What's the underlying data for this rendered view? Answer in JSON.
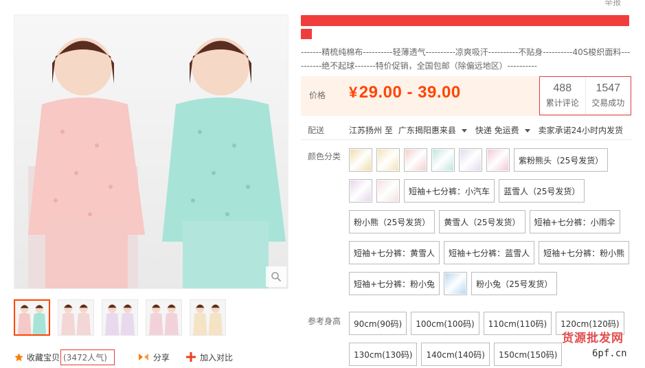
{
  "header": {
    "report_label": "举报"
  },
  "product": {
    "subtitle": "-------精梳纯棉布----------轻薄透气----------凉爽吸汗----------不贴身----------40S梭织面料----------绝不起球-------特价促销，全国包邮（除偏远地区）----------"
  },
  "gallery": {
    "thumbnail_count": 5,
    "active_thumbnail": 0,
    "thumb_colors": [
      "#f6c9c9",
      "#f3d6d6",
      "#e9d9ee",
      "#f2d2da",
      "#f4e3c5"
    ]
  },
  "actions": {
    "favorite_label": "收藏宝贝",
    "popularity": "(3472人气)",
    "share_label": "分享",
    "compare_label": "加入对比"
  },
  "price": {
    "label": "价格",
    "currency": "¥",
    "range": "29.00 - 39.00"
  },
  "stats": {
    "reviews_count": "488",
    "reviews_label": "累计评论",
    "deals_count": "1547",
    "deals_label": "交易成功"
  },
  "shipping": {
    "label": "配送",
    "origin": "江苏扬州 至",
    "destination": "广东揭阳惠来县",
    "method": "快递 免运费",
    "promise": "卖家承诺24小时内发货"
  },
  "sku": {
    "color_label": "颜色分类",
    "colors": [
      {
        "type": "image",
        "swatch": "#f1dca9"
      },
      {
        "type": "image",
        "swatch": "#f3e3b8"
      },
      {
        "type": "image",
        "swatch": "#f3cfcf"
      },
      {
        "type": "image",
        "swatch": "#bfe6df"
      },
      {
        "type": "image",
        "swatch": "#e3dbee"
      },
      {
        "type": "image",
        "swatch": "#f2c9d3"
      },
      {
        "type": "text",
        "label": "紫粉熊头（25号发货）"
      },
      {
        "type": "image",
        "swatch": "#e6d6ec"
      },
      {
        "type": "image",
        "swatch": "#f6e0e0"
      },
      {
        "type": "text",
        "label": "短袖+七分裤：小汽车"
      },
      {
        "type": "text",
        "label": "蓝雪人（25号发货）"
      },
      {
        "type": "text",
        "label": "粉小熊（25号发货）"
      },
      {
        "type": "text",
        "label": "黄雪人（25号发货）"
      },
      {
        "type": "text",
        "label": "短袖+七分裤：小雨伞"
      },
      {
        "type": "text",
        "label": "短袖+七分裤：黄雪人"
      },
      {
        "type": "text",
        "label": "短袖+七分裤：蓝雪人"
      },
      {
        "type": "text",
        "label": "短袖+七分裤：粉小熊"
      },
      {
        "type": "text",
        "label": "短袖+七分裤：粉小兔"
      },
      {
        "type": "image",
        "swatch": "#b9d7ee"
      },
      {
        "type": "text",
        "label": "粉小兔（25号发货）"
      }
    ],
    "size_label": "参考身高",
    "sizes": [
      "90cm(90码)",
      "100cm(100码)",
      "110cm(110码)",
      "120cm(120码)",
      "130cm(130码)",
      "140cm(140码)",
      "150cm(150码)"
    ]
  },
  "watermark": {
    "brand": "货源批发网",
    "domain": "6pf.cn"
  },
  "colors": {
    "accent": "#ff4400",
    "border_highlight": "#e4393c",
    "price_bg": "#fff2e8"
  }
}
